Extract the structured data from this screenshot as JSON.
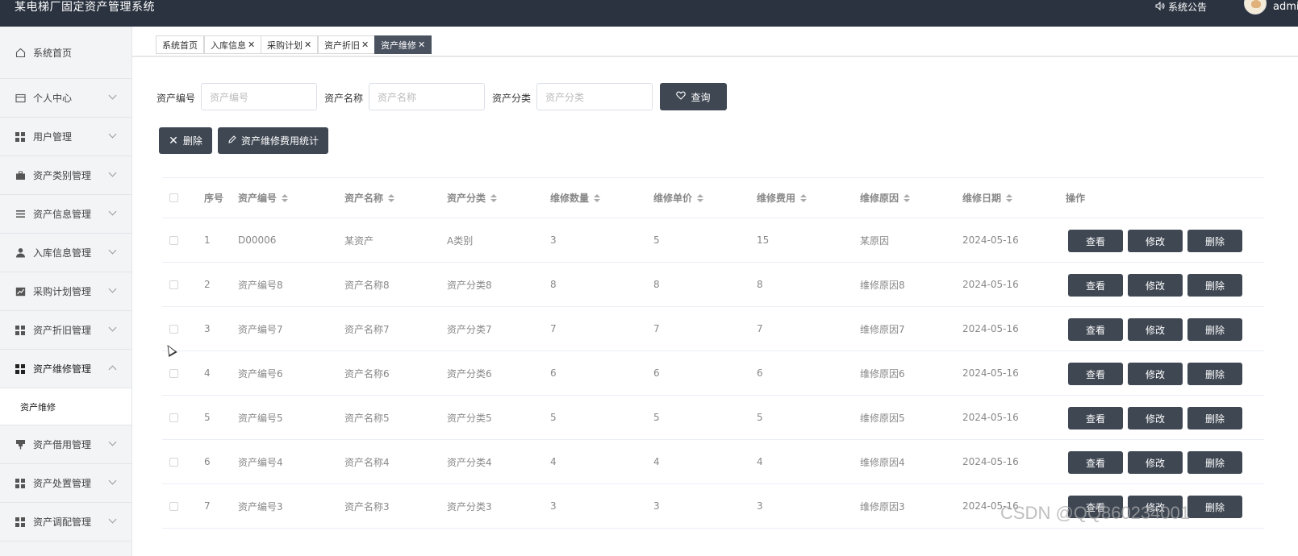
{
  "header": {
    "title": "某电梯厂固定资产管理系统",
    "notice": "系统公告",
    "user": "admin"
  },
  "sidebar": {
    "items": [
      {
        "label": "系统首页",
        "icon": "home-icon",
        "expanded": null
      },
      {
        "label": "个人中心",
        "icon": "card-icon",
        "expanded": false
      },
      {
        "label": "用户管理",
        "icon": "grid-icon",
        "expanded": false
      },
      {
        "label": "资产类别管理",
        "icon": "briefcase-icon",
        "expanded": false
      },
      {
        "label": "资产信息管理",
        "icon": "list-icon",
        "expanded": false
      },
      {
        "label": "入库信息管理",
        "icon": "user-icon",
        "expanded": false
      },
      {
        "label": "采购计划管理",
        "icon": "chart-icon",
        "expanded": false
      },
      {
        "label": "资产折旧管理",
        "icon": "grid-icon",
        "expanded": false
      },
      {
        "label": "资产维修管理",
        "icon": "grid-icon",
        "expanded": true
      },
      {
        "label": "资产借用管理",
        "icon": "pin-icon",
        "expanded": false
      },
      {
        "label": "资产处置管理",
        "icon": "grid-icon",
        "expanded": false
      },
      {
        "label": "资产调配管理",
        "icon": "grid-icon",
        "expanded": false
      }
    ],
    "submenu_label": "资产维修"
  },
  "tabs": [
    {
      "label": "系统首页",
      "closable": false,
      "active": false
    },
    {
      "label": "入库信息",
      "closable": true,
      "active": false
    },
    {
      "label": "采购计划",
      "closable": true,
      "active": false
    },
    {
      "label": "资产折旧",
      "closable": true,
      "active": false
    },
    {
      "label": "资产维修",
      "closable": true,
      "active": true
    }
  ],
  "search": {
    "code_label": "资产编号",
    "code_placeholder": "资产编号",
    "name_label": "资产名称",
    "name_placeholder": "资产名称",
    "category_label": "资产分类",
    "category_placeholder": "资产分类",
    "query_button": "查询"
  },
  "actions": {
    "delete_button": "删除",
    "stats_button": "资产维修费用统计"
  },
  "table": {
    "headers": {
      "index": "序号",
      "code": "资产编号",
      "name": "资产名称",
      "category": "资产分类",
      "quantity": "维修数量",
      "unit_price": "维修单价",
      "cost": "维修费用",
      "reason": "维修原因",
      "date": "维修日期",
      "ops": "操作"
    },
    "rows": [
      {
        "index": "1",
        "code": "D00006",
        "name": "某资产",
        "category": "A类别",
        "quantity": "3",
        "unit_price": "5",
        "cost": "15",
        "reason": "某原因",
        "date": "2024-05-16"
      },
      {
        "index": "2",
        "code": "资产编号8",
        "name": "资产名称8",
        "category": "资产分类8",
        "quantity": "8",
        "unit_price": "8",
        "cost": "8",
        "reason": "维修原因8",
        "date": "2024-05-16"
      },
      {
        "index": "3",
        "code": "资产编号7",
        "name": "资产名称7",
        "category": "资产分类7",
        "quantity": "7",
        "unit_price": "7",
        "cost": "7",
        "reason": "维修原因7",
        "date": "2024-05-16"
      },
      {
        "index": "4",
        "code": "资产编号6",
        "name": "资产名称6",
        "category": "资产分类6",
        "quantity": "6",
        "unit_price": "6",
        "cost": "6",
        "reason": "维修原因6",
        "date": "2024-05-16"
      },
      {
        "index": "5",
        "code": "资产编号5",
        "name": "资产名称5",
        "category": "资产分类5",
        "quantity": "5",
        "unit_price": "5",
        "cost": "5",
        "reason": "维修原因5",
        "date": "2024-05-16"
      },
      {
        "index": "6",
        "code": "资产编号4",
        "name": "资产名称4",
        "category": "资产分类4",
        "quantity": "4",
        "unit_price": "4",
        "cost": "4",
        "reason": "维修原因4",
        "date": "2024-05-16"
      },
      {
        "index": "7",
        "code": "资产编号3",
        "name": "资产名称3",
        "category": "资产分类3",
        "quantity": "3",
        "unit_price": "3",
        "cost": "3",
        "reason": "维修原因3",
        "date": "2024-05-16"
      }
    ],
    "op_labels": {
      "view": "查看",
      "edit": "修改",
      "delete": "删除"
    }
  },
  "watermark": "CSDN @QQ860234001",
  "colors": {
    "topbar": "#2b3340",
    "button": "#3f4753",
    "active_tab": "#4a5260",
    "sidebar_bg": "#f3f4f6"
  }
}
